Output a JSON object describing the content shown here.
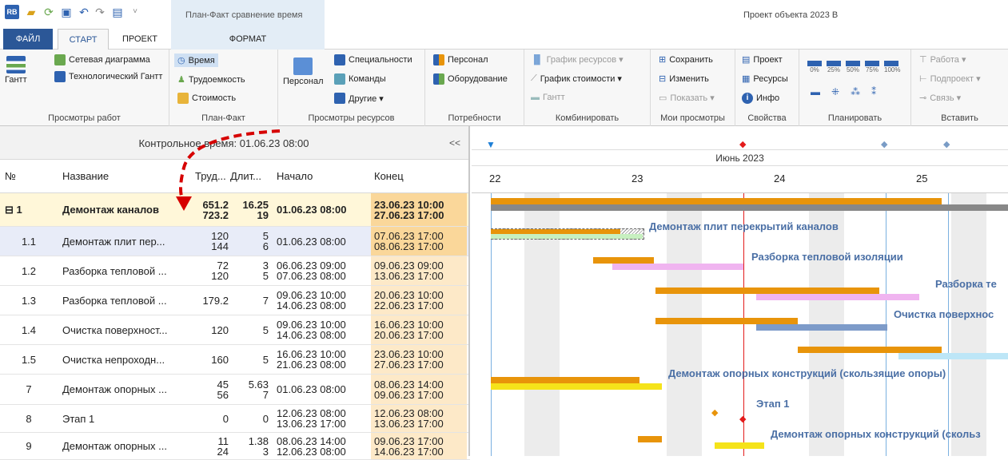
{
  "window": {
    "context_tab": "План-Факт сравнение время",
    "title": "Проект объекта 2023 В"
  },
  "tabs": {
    "file": "ФАЙЛ",
    "start": "СТАРТ",
    "project": "ПРОЕКТ",
    "format": "ФОРМАТ"
  },
  "ribbon": {
    "g1": {
      "label": "Просмотры работ",
      "gantt": "Гантт",
      "network": "Сетевая диаграмма",
      "tech_gantt": "Технологический Гантт"
    },
    "g2": {
      "label": "План-Факт",
      "time": "Время",
      "labor": "Трудоемкость",
      "cost": "Стоимость"
    },
    "g3": {
      "label": "Просмотры ресурсов",
      "personnel": "Персонал",
      "specialties": "Специальности",
      "teams": "Команды",
      "others": "Другие ▾"
    },
    "g4": {
      "label": "Потребности",
      "personnel": "Персонал",
      "equipment": "Оборудование"
    },
    "g5": {
      "label": "Комбинировать",
      "resource_chart": "График ресурсов ▾",
      "cost_chart": "График стоимости ▾",
      "gantt": "Гантт"
    },
    "g6": {
      "label": "Мои просмотры",
      "save": "Сохранить",
      "change": "Изменить",
      "show": "Показать ▾"
    },
    "g7": {
      "label": "Свойства",
      "project": "Проект",
      "resources": "Ресурсы",
      "info": "Инфо"
    },
    "g8": {
      "label": "Планировать",
      "p0": "0%",
      "p25": "25%",
      "p50": "50%",
      "p75": "75%",
      "p100": "100%"
    },
    "g9": {
      "label": "Вставить",
      "work": "Работа ▾",
      "subproject": "Подпроект ▾",
      "link": "Связь ▾"
    }
  },
  "grid": {
    "control_time": "Контрольное время: 01.06.23 08:00",
    "collapse": "<<",
    "headers": {
      "num": "№",
      "name": "Название",
      "labor": "Труд...",
      "dur": "Длит...",
      "start": "Начало",
      "end": "Конец"
    },
    "rows": [
      {
        "num": "⊟ 1",
        "name": "Демонтаж каналов",
        "labor1": "651.2",
        "labor2": "723.2",
        "dur1": "16.25",
        "dur2": "19",
        "start1": "01.06.23 08:00",
        "start2": "",
        "end1": "23.06.23 10:00",
        "end2": "27.06.23 17:00"
      },
      {
        "num": "1.1",
        "name": "Демонтаж плит пер...",
        "labor1": "120",
        "labor2": "144",
        "dur1": "5",
        "dur2": "6",
        "start1": "01.06.23 08:00",
        "start2": "",
        "end1": "07.06.23 17:00",
        "end2": "08.06.23 17:00"
      },
      {
        "num": "1.2",
        "name": "Разборка тепловой ...",
        "labor1": "72",
        "labor2": "120",
        "dur1": "3",
        "dur2": "5",
        "start1": "06.06.23 09:00",
        "start2": "07.06.23 08:00",
        "end1": "09.06.23 09:00",
        "end2": "13.06.23 17:00"
      },
      {
        "num": "1.3",
        "name": "Разборка тепловой ...",
        "labor1": "179.2",
        "labor2": "",
        "dur1": "7",
        "dur2": "",
        "start1": "09.06.23 10:00",
        "start2": "14.06.23 08:00",
        "end1": "20.06.23 10:00",
        "end2": "22.06.23 17:00"
      },
      {
        "num": "1.4",
        "name": "Очистка поверхност...",
        "labor1": "120",
        "labor2": "",
        "dur1": "5",
        "dur2": "",
        "start1": "09.06.23 10:00",
        "start2": "14.06.23 08:00",
        "end1": "16.06.23 10:00",
        "end2": "20.06.23 17:00"
      },
      {
        "num": "1.5",
        "name": "Очистка непроходн...",
        "labor1": "160",
        "labor2": "",
        "dur1": "5",
        "dur2": "",
        "start1": "16.06.23 10:00",
        "start2": "21.06.23 08:00",
        "end1": "23.06.23 10:00",
        "end2": "27.06.23 17:00"
      },
      {
        "num": "7",
        "name": "Демонтаж опорных ...",
        "labor1": "45",
        "labor2": "56",
        "dur1": "5.63",
        "dur2": "7",
        "start1": "01.06.23 08:00",
        "start2": "",
        "end1": "08.06.23 14:00",
        "end2": "09.06.23 17:00"
      },
      {
        "num": "8",
        "name": "Этап 1",
        "labor1": "0",
        "labor2": "",
        "dur1": "0",
        "dur2": "",
        "start1": "12.06.23 08:00",
        "start2": "13.06.23 17:00",
        "end1": "12.06.23 08:00",
        "end2": "13.06.23 17:00"
      },
      {
        "num": "9",
        "name": "Демонтаж опорных ...",
        "labor1": "11",
        "labor2": "24",
        "dur1": "1.38",
        "dur2": "3",
        "start1": "08.06.23 14:00",
        "start2": "12.06.23 08:00",
        "end1": "09.06.23 17:00",
        "end2": "14.06.23 17:00"
      }
    ]
  },
  "gantt": {
    "month": "Июнь 2023",
    "days": [
      "22",
      "23",
      "24",
      "25"
    ],
    "labels": {
      "l1": "Демонтаж  плит перекрытий каналов",
      "l2": "Разборка тепловой изоляции",
      "l3": "Разборка те",
      "l4": "Очистка поверхнос",
      "l5": "Демонтаж опорных конструкций (скользящие опоры)",
      "l6": "Этап 1",
      "l7": "Демонтаж опорных конструкций (скольз"
    }
  },
  "colors": {
    "plan": "#e8940a",
    "fact": "#888888",
    "accent": "#1f5fa8"
  }
}
